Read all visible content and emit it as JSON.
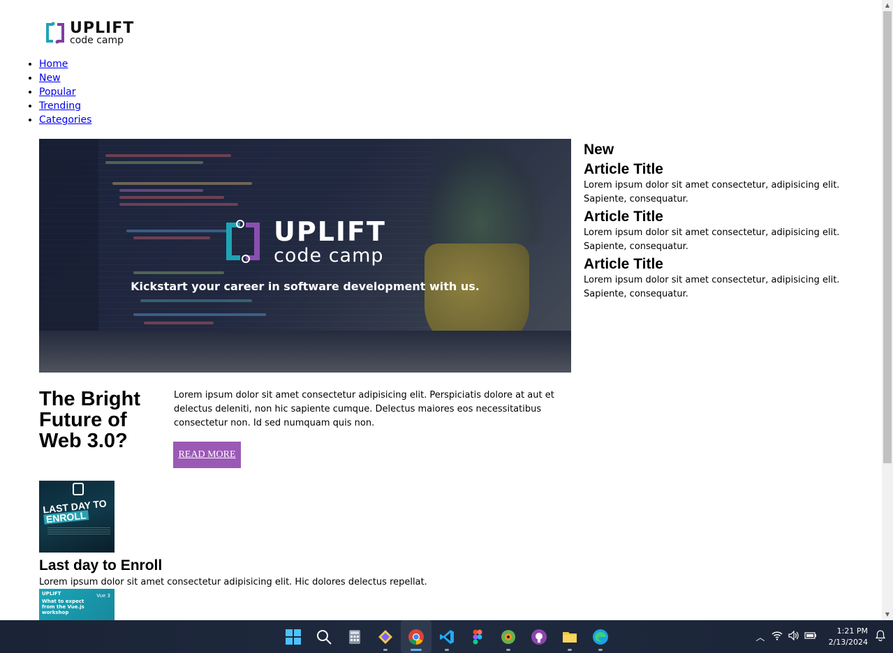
{
  "logo": {
    "top": "UPLIFT",
    "bottom": "code camp"
  },
  "nav": [
    "Home",
    "New",
    "Popular",
    "Trending",
    "Categories"
  ],
  "hero": {
    "logo_top": "UPLIFT",
    "logo_bottom": "code camp",
    "tagline": "Kickstart your career in software development with us."
  },
  "featured": {
    "title": "The Bright Future of Web 3.0?",
    "body": "Lorem ipsum dolor sit amet consectetur adipisicing elit. Perspiciatis dolore at aut et delectus deleniti, non hic sapiente cumque. Delectus maiores eos necessitatibus consectetur non. Id sed numquam quis non.",
    "button": "READ MORE"
  },
  "side": {
    "heading": "New",
    "articles": [
      {
        "title": "Article Title",
        "text": "Lorem ipsum dolor sit amet consectetur, adipisicing elit. Sapiente, consequatur."
      },
      {
        "title": "Article Title",
        "text": "Lorem ipsum dolor sit amet consectetur, adipisicing elit. Sapiente, consequatur."
      },
      {
        "title": "Article Title",
        "text": "Lorem ipsum dolor sit amet consectetur, adipisicing elit. Sapiente, consequatur."
      }
    ]
  },
  "cards": [
    {
      "image_text_1": "LAST DAY TO",
      "image_text_2": "ENROLL",
      "title": "Last day to Enroll",
      "text": "Lorem ipsum dolor sit amet consectetur adipisicing elit. Hic dolores delectus repellat."
    },
    {
      "image_logo": "UPLIFT",
      "image_text": "What to expect from the Vue.js workshop",
      "image_badge": "Vue 3"
    }
  ],
  "taskbar": {
    "apps": [
      "windows-start",
      "search",
      "calculator",
      "git-kraken",
      "chrome",
      "vs-code",
      "figma",
      "some-app",
      "github-desktop",
      "file-explorer",
      "edge"
    ],
    "time": "1:21 PM",
    "date": "2/13/2024"
  },
  "colors": {
    "accent": "#9b59b6",
    "link": "#0000ee",
    "taskbar": "#1f2a3f"
  }
}
